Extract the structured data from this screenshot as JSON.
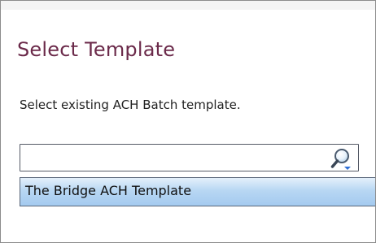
{
  "dialog": {
    "title": "Select Template",
    "instruction": "Select existing ACH Batch template."
  },
  "search": {
    "value": "",
    "placeholder": "",
    "icon": "search-icon"
  },
  "dropdown": {
    "items": [
      {
        "label": "The Bridge ACH Template",
        "selected": true
      }
    ]
  },
  "colors": {
    "title": "#6b2a4a",
    "highlight": "#b8d7f3",
    "border": "#8c8c8c"
  }
}
